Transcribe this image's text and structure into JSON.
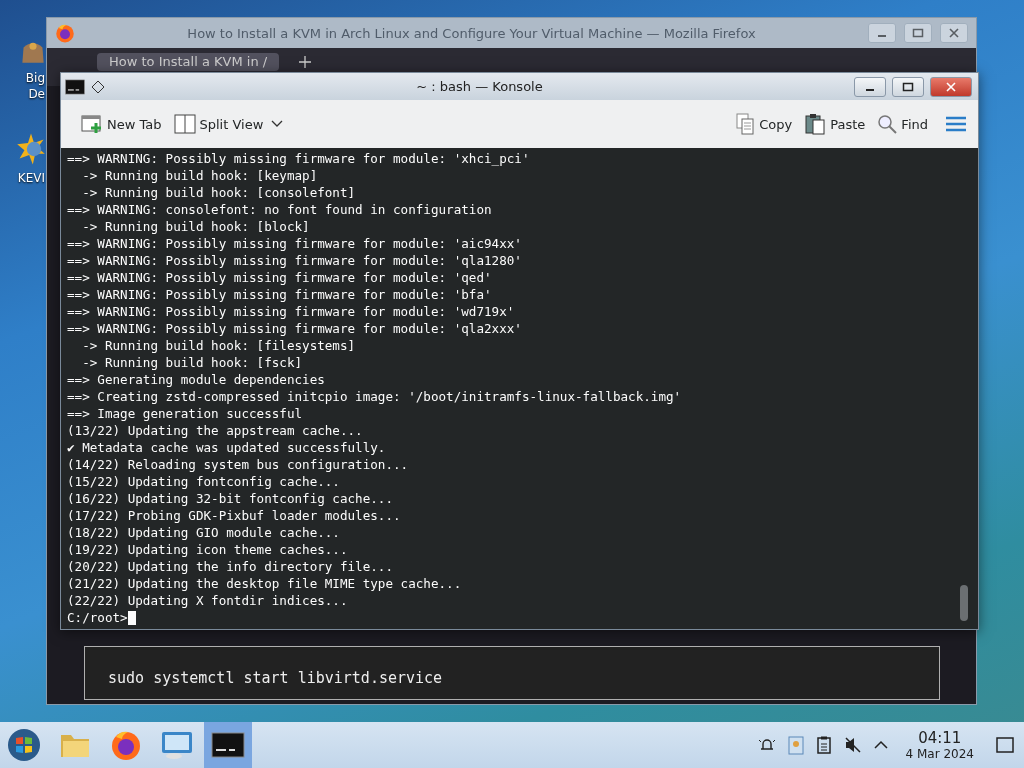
{
  "desktop_icons": [
    {
      "lines": [
        "Big",
        "De"
      ],
      "kind": "bag"
    },
    {
      "lines": [
        "KEVI"
      ],
      "kind": "sun"
    }
  ],
  "browser": {
    "title": "How to Install a KVM in Arch Linux and Configure Your Virtual Machine — Mozilla Firefox",
    "tab": {
      "label": "How to Install a KVM in /",
      "selected": true
    },
    "code_block": "sudo systemctl start libvirtd.service"
  },
  "konsole": {
    "title": "~ : bash — Konsole",
    "toolbar": [
      {
        "label": "New Tab",
        "kind": "new-tab"
      },
      {
        "label": "Split View",
        "kind": "split-view"
      },
      {
        "label": "Copy",
        "kind": "copy"
      },
      {
        "label": "Paste",
        "kind": "paste"
      },
      {
        "label": "Find",
        "kind": "find"
      }
    ],
    "lines": [
      "==> WARNING: Possibly missing firmware for module: 'xhci_pci'",
      "  -> Running build hook: [keymap]",
      "  -> Running build hook: [consolefont]",
      "==> WARNING: consolefont: no font found in configuration",
      "  -> Running build hook: [block]",
      "==> WARNING: Possibly missing firmware for module: 'aic94xx'",
      "==> WARNING: Possibly missing firmware for module: 'qla1280'",
      "==> WARNING: Possibly missing firmware for module: 'qed'",
      "==> WARNING: Possibly missing firmware for module: 'bfa'",
      "==> WARNING: Possibly missing firmware for module: 'wd719x'",
      "==> WARNING: Possibly missing firmware for module: 'qla2xxx'",
      "  -> Running build hook: [filesystems]",
      "  -> Running build hook: [fsck]",
      "==> Generating module dependencies",
      "==> Creating zstd-compressed initcpio image: '/boot/initramfs-linux-fallback.img'",
      "==> Image generation successful",
      "(13/22) Updating the appstream cache...",
      "✔ Metadata cache was updated successfully.",
      "(14/22) Reloading system bus configuration...",
      "(15/22) Updating fontconfig cache...",
      "(16/22) Updating 32-bit fontconfig cache...",
      "(17/22) Probing GDK-Pixbuf loader modules...",
      "(18/22) Updating GIO module cache...",
      "(19/22) Updating icon theme caches...",
      "(20/22) Updating the info directory file...",
      "(21/22) Updating the desktop file MIME type cache...",
      "(22/22) Updating X fontdir indices..."
    ],
    "prompt": "C:/root>"
  },
  "taskbar": {
    "apps": [
      {
        "kind": "start",
        "selected": false
      },
      {
        "kind": "folder",
        "selected": false
      },
      {
        "kind": "firefox",
        "selected": false
      },
      {
        "kind": "monitor",
        "selected": false
      },
      {
        "kind": "terminal",
        "selected": true
      }
    ],
    "time": "04:11",
    "date": "4 Mar 2024"
  }
}
